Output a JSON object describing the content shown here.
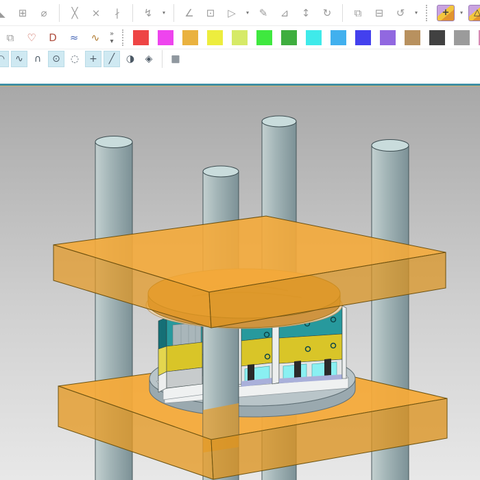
{
  "app": {
    "name": "NX CAD modeling window",
    "description": "3D viewport showing a translucent injection-mold die set: two orange clamp plates, four steel guide pillars, center mold stack on a round turntable"
  },
  "palette": {
    "colors": [
      "#ee4545",
      "#ee44ee",
      "#eab23f",
      "#eded3e",
      "#d6ea67",
      "#3fe83f",
      "#3fae3f",
      "#3feaea",
      "#41b0ee",
      "#4340ee",
      "#9168e0",
      "#b8915f",
      "#414141",
      "#9b9b9b",
      "#d789b3",
      "#db8077",
      "#edbd72"
    ]
  },
  "toolbars": {
    "row1": [
      {
        "name": "edge-icon-partial",
        "t": "icon",
        "g": "◣",
        "clip": "l"
      },
      {
        "name": "datum-plane-icon",
        "t": "icon",
        "g": "⊞"
      },
      {
        "name": "revolve-body-icon",
        "t": "icon",
        "g": "⌀"
      },
      {
        "name": "separator",
        "t": "sep"
      },
      {
        "name": "trim-curve-icon",
        "t": "icon",
        "g": "╳"
      },
      {
        "name": "trim-body-icon",
        "t": "icon",
        "g": "×"
      },
      {
        "name": "divide-curve-icon",
        "t": "icon",
        "g": "∤"
      },
      {
        "name": "separator",
        "t": "sep"
      },
      {
        "name": "rapid-dimension-icon",
        "t": "icon",
        "g": "↯"
      },
      {
        "name": "rapid-dimension-dropdown",
        "t": "dd"
      },
      {
        "name": "separator",
        "t": "sep"
      },
      {
        "name": "draft-angle-icon",
        "t": "icon",
        "g": "∠"
      },
      {
        "name": "pattern-feature-icon",
        "t": "icon",
        "g": "⊡"
      },
      {
        "name": "mirror-feature-icon",
        "t": "icon",
        "g": "▷"
      },
      {
        "name": "mirror-feature-dropdown",
        "t": "dd"
      },
      {
        "name": "edit-feature-icon",
        "t": "icon",
        "g": "✎"
      },
      {
        "name": "chamfer-tool-icon",
        "t": "icon",
        "g": "⊿"
      },
      {
        "name": "adjust-size-icon",
        "t": "icon",
        "g": "↕"
      },
      {
        "name": "replace-feature-icon",
        "t": "icon",
        "g": "↻"
      },
      {
        "name": "separator",
        "t": "sep"
      },
      {
        "name": "copy-geometry-icon",
        "t": "icon",
        "g": "⧉"
      },
      {
        "name": "lock-geometry-icon",
        "t": "icon",
        "g": "⊟"
      },
      {
        "name": "reorder-feature-icon",
        "t": "icon",
        "g": "↺"
      },
      {
        "name": "reorder-feature-dropdown",
        "t": "dd"
      },
      {
        "name": "toolbar-handle",
        "t": "dot"
      },
      {
        "name": "move-face-icon",
        "t": "cube",
        "g": "+"
      },
      {
        "name": "move-face-dropdown",
        "t": "dd"
      },
      {
        "name": "pull-face-icon",
        "t": "cube",
        "g": "△"
      },
      {
        "name": "pull-face-dropdown",
        "t": "dd"
      },
      {
        "name": "delete-face-icon",
        "t": "cube",
        "g": "×"
      },
      {
        "name": "cube-icon-partial",
        "t": "cube",
        "g": "",
        "clip": "r"
      }
    ],
    "row2": [
      {
        "name": "extract-geometry-icon",
        "t": "icon",
        "g": "⧉"
      },
      {
        "name": "bounded-plane-icon",
        "t": "icon",
        "g": "♡",
        "c": "#c4503f"
      },
      {
        "name": "fill-surface-icon",
        "t": "icon",
        "g": "D",
        "c": "#b05040"
      },
      {
        "name": "through-curves-icon",
        "t": "icon",
        "g": "≈",
        "c": "#4a6ab8"
      },
      {
        "name": "project-curve-icon",
        "t": "icon",
        "g": "∿",
        "c": "#b07a30"
      },
      {
        "name": "toolbar-overflow",
        "t": "ovf"
      },
      {
        "name": "palette-handle",
        "t": "dot"
      },
      {
        "name": "color-palette",
        "t": "palette"
      }
    ],
    "row3": [
      {
        "name": "profile-icon-partial",
        "t": "icon",
        "g": "◠",
        "hl": true,
        "clip": "l"
      },
      {
        "name": "studio-spline-icon",
        "t": "icon",
        "g": "∿",
        "hl": true
      },
      {
        "name": "arc-icon",
        "t": "icon",
        "g": "∩"
      },
      {
        "name": "circle-icon",
        "t": "icon",
        "g": "⊙",
        "hl": true
      },
      {
        "name": "ellipse-icon",
        "t": "icon",
        "g": "◌"
      },
      {
        "name": "point-icon",
        "t": "icon",
        "g": "+",
        "hl": true
      },
      {
        "name": "line-icon",
        "t": "icon",
        "g": "╱",
        "hl": true
      },
      {
        "name": "surface-icon",
        "t": "icon",
        "g": "◑"
      },
      {
        "name": "mesh-surface-icon",
        "t": "icon",
        "g": "◈"
      },
      {
        "name": "separator",
        "t": "sep"
      },
      {
        "name": "grid-icon",
        "t": "icon",
        "g": "▦"
      }
    ],
    "overflow_more": "»",
    "overflow_down": "▾"
  },
  "scene": {
    "parts": [
      "guide-pillar-1",
      "guide-pillar-2",
      "guide-pillar-3",
      "guide-pillar-4",
      "top-clamp-plate",
      "bottom-clamp-plate",
      "locating-ring-disc",
      "turntable-disc",
      "mold-stack-left",
      "mold-stack-middle",
      "mold-stack-right",
      "base-plate"
    ],
    "colors": {
      "background_top": "#a8a8a8",
      "background_mid": "#cfcfcf",
      "background_bottom": "#e8e8e8",
      "pillar_light": "#c3d0d0",
      "pillar_mid": "#a3b5b7",
      "pillar_dark": "#7c9196",
      "pillar_top": "#c9dcdc",
      "pillar_outline": "#45565a",
      "plate_top": "#f4aa3a",
      "plate_front_left": "#e69a24",
      "plate_front_right": "#dd9420",
      "plate_outline": "#5f4a10",
      "ring_disc": "#e3a74d",
      "ring_disc_side": "#cf9440",
      "cream_disc": "#ead4b2",
      "turntable_top": "#b9c5c9",
      "turntable_side": "#9aa9af",
      "teal_block": "#27999d",
      "teal_side": "#156f76",
      "yellow_block": "#d9c528",
      "yellow_side": "#e4d64e",
      "white_block": "#e4e6e6",
      "white_side": "#eceeee",
      "gray_block": "#c7cbcc",
      "cyan_insert": "#8af0f2",
      "lavender_strip": "#a9b0da",
      "clamp_dark": "#2a2a2a",
      "base_plate_top": "#f8f9f9",
      "base_plate_front": "#eff1f1",
      "window_recess": "#a9b6ba",
      "sill_yellow": "#e8ea3c",
      "tan_strip": "#e9cdb6",
      "hole_ring": "#0e4548",
      "frame_teal": "#3f8fa4",
      "frame_tan": "#d2b070"
    }
  }
}
